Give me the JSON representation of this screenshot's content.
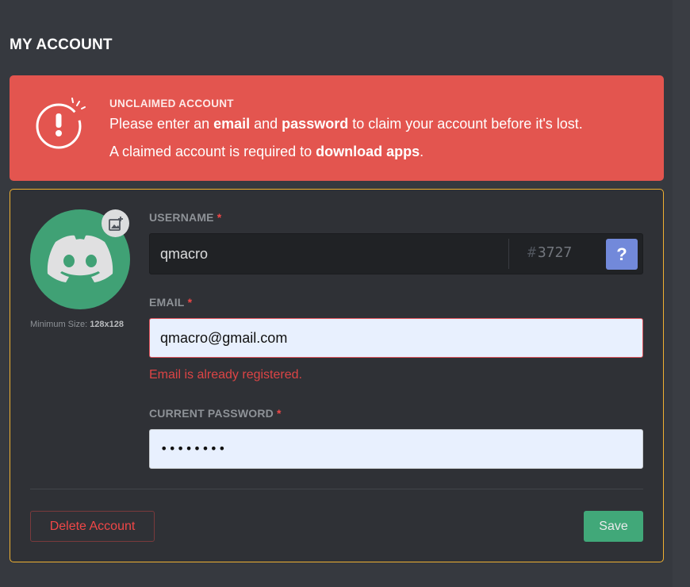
{
  "page": {
    "title": "MY ACCOUNT"
  },
  "banner": {
    "heading": "UNCLAIMED ACCOUNT",
    "line1": {
      "pre": "Please enter an ",
      "b1": "email",
      "mid": " and ",
      "b2": "password",
      "post": " to claim your account before it's lost."
    },
    "line2": {
      "pre": "A claimed account is required to ",
      "b1": "download apps",
      "post": "."
    },
    "color": "#e3554f"
  },
  "profile": {
    "avatar_icon": "discord-logo-icon",
    "upload_icon": "image-upload-icon",
    "min_size_label": "Minimum Size: ",
    "min_size_value": "128x128"
  },
  "form": {
    "username": {
      "label": "USERNAME",
      "required_mark": "*",
      "value": "qmacro",
      "discriminator_hash": "#",
      "discriminator": "3727",
      "help_label": "?"
    },
    "email": {
      "label": "EMAIL",
      "required_mark": "*",
      "value": "qmacro@gmail.com",
      "error": "Email is already registered."
    },
    "password": {
      "label": "CURRENT PASSWORD",
      "required_mark": "*",
      "value": "••••••••"
    }
  },
  "actions": {
    "delete_label": "Delete Account",
    "save_label": "Save"
  },
  "colors": {
    "accent": "#7289da",
    "success": "#43b581",
    "danger": "#f04747",
    "warning_border": "#f0b132"
  }
}
